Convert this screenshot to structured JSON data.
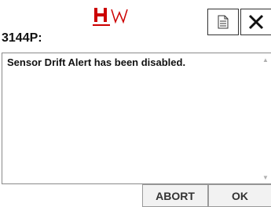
{
  "header": {
    "logo_text": "HW",
    "title": "3144P:",
    "doc_icon": "document-icon",
    "close_icon": "close-icon"
  },
  "message": {
    "text": "Sensor Drift Alert has been disabled."
  },
  "scrollbar": {
    "up_icon": "scroll-up-arrow-icon",
    "down_icon": "scroll-down-arrow-icon"
  },
  "footer": {
    "abort_label": "ABORT",
    "ok_label": "OK"
  },
  "colors": {
    "logo_red": "#cc0000",
    "border": "#333333",
    "button_bg": "#f2f2f2"
  }
}
